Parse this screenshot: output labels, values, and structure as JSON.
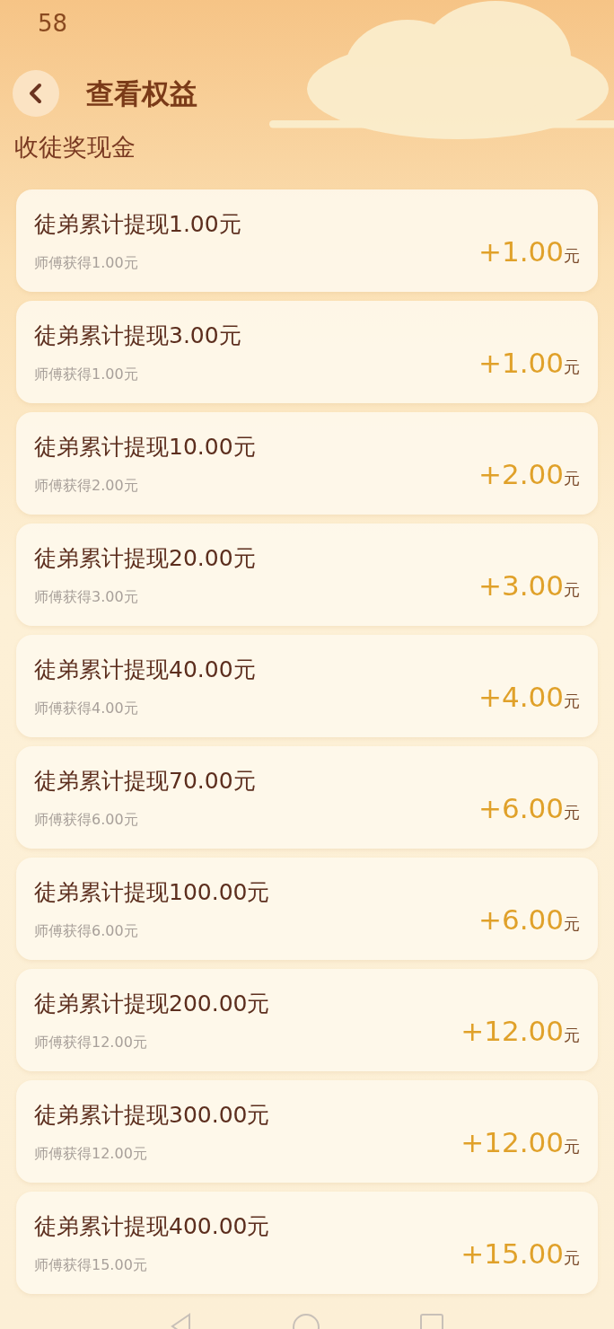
{
  "status_bar": {
    "time": "58"
  },
  "header": {
    "title": "查看权益"
  },
  "section_title": "收徒奖现金",
  "rewards": [
    {
      "title": "徒弟累计提现1.00元",
      "subtitle": "师傅获得1.00元",
      "amount": "+1.00",
      "unit": "元"
    },
    {
      "title": "徒弟累计提现3.00元",
      "subtitle": "师傅获得1.00元",
      "amount": "+1.00",
      "unit": "元"
    },
    {
      "title": "徒弟累计提现10.00元",
      "subtitle": "师傅获得2.00元",
      "amount": "+2.00",
      "unit": "元"
    },
    {
      "title": "徒弟累计提现20.00元",
      "subtitle": "师傅获得3.00元",
      "amount": "+3.00",
      "unit": "元"
    },
    {
      "title": "徒弟累计提现40.00元",
      "subtitle": "师傅获得4.00元",
      "amount": "+4.00",
      "unit": "元"
    },
    {
      "title": "徒弟累计提现70.00元",
      "subtitle": "师傅获得6.00元",
      "amount": "+6.00",
      "unit": "元"
    },
    {
      "title": "徒弟累计提现100.00元",
      "subtitle": "师傅获得6.00元",
      "amount": "+6.00",
      "unit": "元"
    },
    {
      "title": "徒弟累计提现200.00元",
      "subtitle": "师傅获得12.00元",
      "amount": "+12.00",
      "unit": "元"
    },
    {
      "title": "徒弟累计提现300.00元",
      "subtitle": "师傅获得12.00元",
      "amount": "+12.00",
      "unit": "元"
    },
    {
      "title": "徒弟累计提现400.00元",
      "subtitle": "师傅获得15.00元",
      "amount": "+15.00",
      "unit": "元"
    }
  ]
}
